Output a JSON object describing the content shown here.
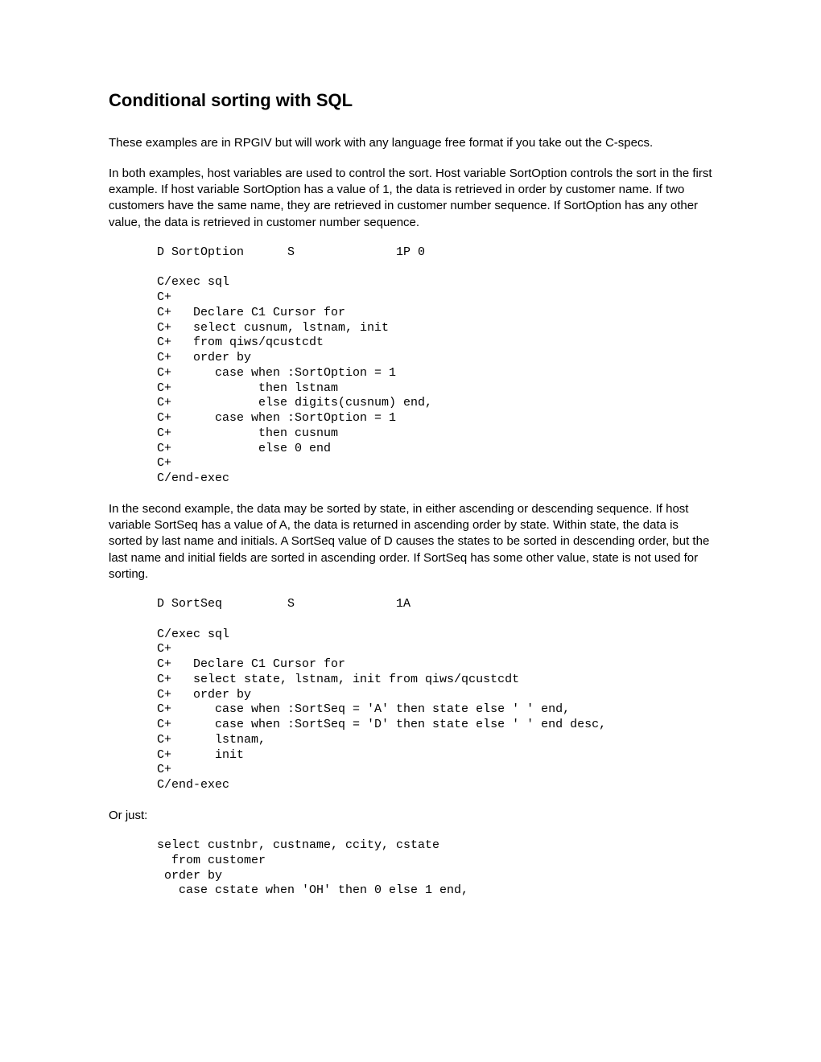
{
  "title": "Conditional sorting with SQL",
  "para1": "These examples are in RPGIV  but will work with any language free format if you take out the C-specs.",
  "para2": "In both examples, host variables are used to control the sort.  Host variable SortOption controls the sort in the first example.  If host variable SortOption has a value of 1, the data is retrieved in order by customer name.  If two customers have the same name, they are retrieved in customer number sequence.  If SortOption has any other value, the data is retrieved in customer number sequence.",
  "code1": "D SortOption      S              1P 0\n\nC/exec sql\nC+\nC+   Declare C1 Cursor for\nC+   select cusnum, lstnam, init\nC+   from qiws/qcustcdt\nC+   order by\nC+      case when :SortOption = 1\nC+            then lstnam\nC+            else digits(cusnum) end,\nC+      case when :SortOption = 1\nC+            then cusnum\nC+            else 0 end\nC+\nC/end-exec",
  "para3": "In the second example, the data may be sorted by state, in either ascending or descending sequence. If host variable SortSeq has a value of A, the data is returned in ascending order by state.  Within state, the data is sorted by last name and initials. A SortSeq value of D causes the states to be sorted in descending order, but the last name and initial fields are sorted in ascending order. If SortSeq has some other value, state is not used for sorting.",
  "code2": "D SortSeq         S              1A\n\nC/exec sql\nC+\nC+   Declare C1 Cursor for\nC+   select state, lstnam, init from qiws/qcustcdt\nC+   order by\nC+      case when :SortSeq = 'A' then state else ' ' end,\nC+      case when :SortSeq = 'D' then state else ' ' end desc,\nC+      lstnam,\nC+      init\nC+\nC/end-exec",
  "para4": "Or just:",
  "code3": "select custnbr, custname, ccity, cstate\n  from customer\n order by\n   case cstate when 'OH' then 0 else 1 end,"
}
